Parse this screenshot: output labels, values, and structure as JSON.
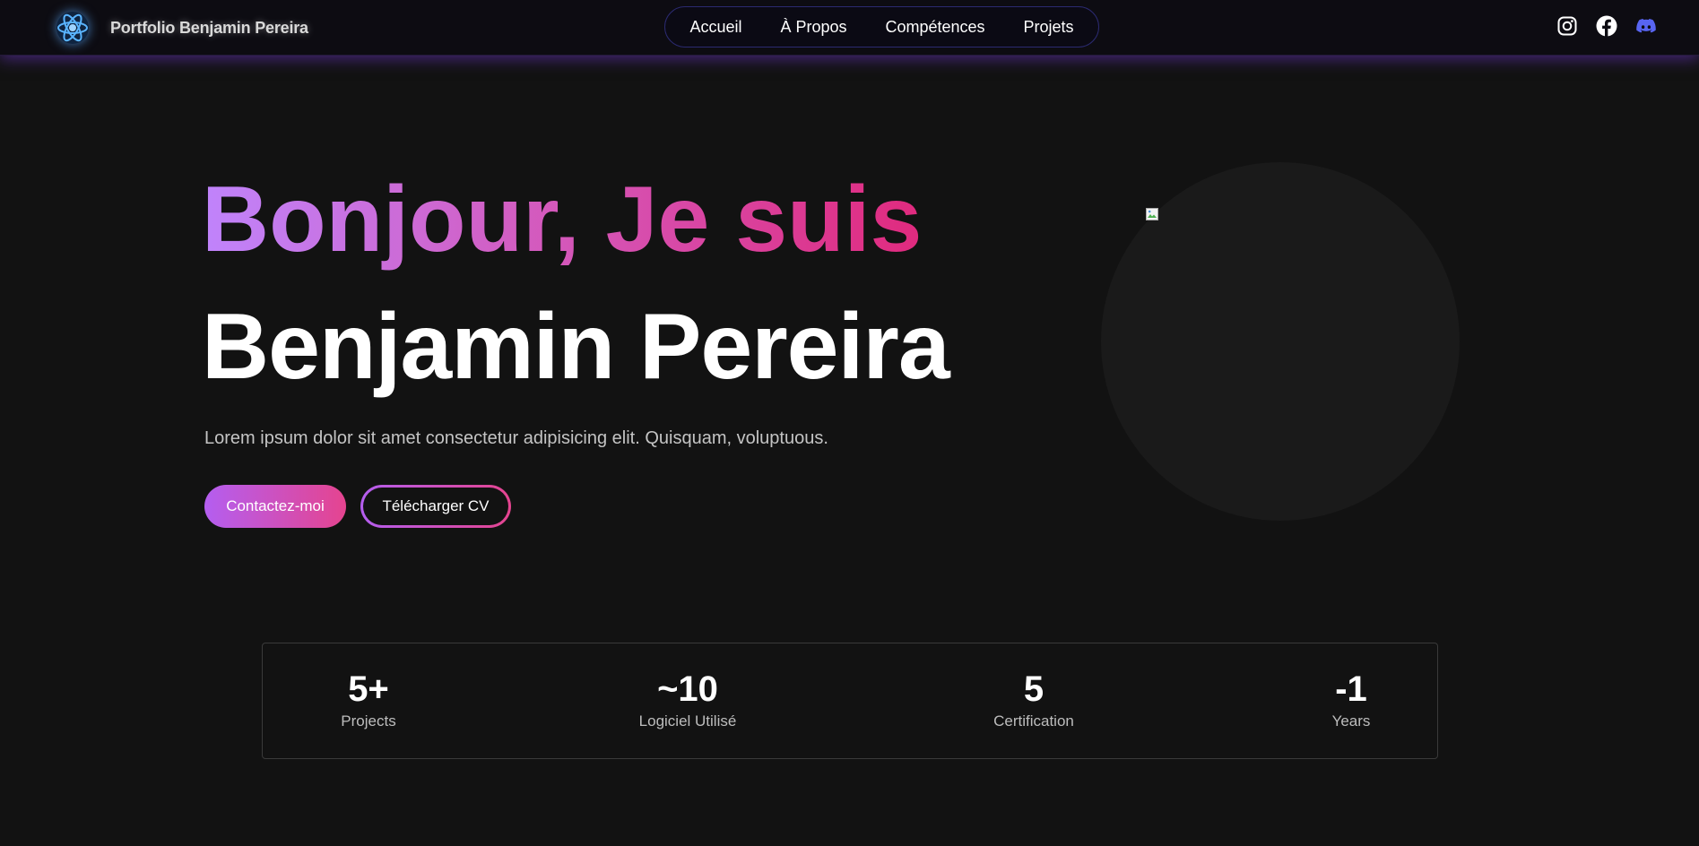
{
  "header": {
    "brand_name": "Portfolio Benjamin Pereira",
    "nav": [
      {
        "label": "Accueil"
      },
      {
        "label": "À Propos"
      },
      {
        "label": "Compétences"
      },
      {
        "label": "Projets"
      }
    ],
    "socials": [
      "instagram-icon",
      "facebook-icon",
      "discord-icon"
    ]
  },
  "hero": {
    "greeting": "Bonjour, Je suis",
    "name": "Benjamin Pereira",
    "description": "Lorem ipsum dolor sit amet consectetur adipisicing elit. Quisquam, voluptuous.",
    "primary_button": "Contactez-moi",
    "secondary_button": "Télécharger CV"
  },
  "stats": [
    {
      "value": "5+",
      "label": "Projects"
    },
    {
      "value": "~10",
      "label": "Logiciel Utilisé"
    },
    {
      "value": "5",
      "label": "Certification"
    },
    {
      "value": "-1",
      "label": "Years"
    }
  ],
  "colors": {
    "background": "#121212",
    "navbar": "#0d0c12",
    "accent_purple": "#b45ef0",
    "accent_pink": "#e5448f",
    "discord": "#5865f2"
  }
}
